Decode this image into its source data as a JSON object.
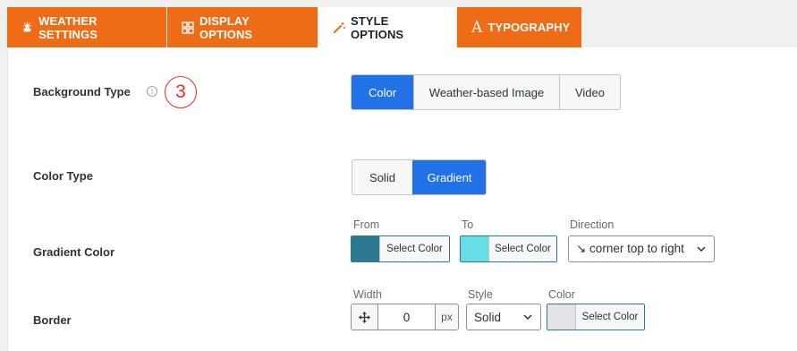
{
  "tabs": [
    {
      "label": "WEATHER SETTINGS",
      "icon": "cloud-sun-icon",
      "active": false
    },
    {
      "label": "DISPLAY OPTIONS",
      "icon": "grid-icon",
      "active": false
    },
    {
      "label": "STYLE OPTIONS",
      "icon": "magic-wand-icon",
      "active": true
    },
    {
      "label": "TYPOGRAPHY",
      "icon": "font-a-icon",
      "active": false
    }
  ],
  "background_type": {
    "label": "Background Type",
    "info_glyph": "i",
    "badge": "3",
    "options": [
      "Color",
      "Weather-based Image",
      "Video"
    ],
    "selected": "Color"
  },
  "color_type": {
    "label": "Color Type",
    "options": [
      "Solid",
      "Gradient"
    ],
    "selected": "Gradient"
  },
  "gradient_color": {
    "label": "Gradient Color",
    "from_label": "From",
    "from_color": "#2c7a8f",
    "from_button": "Select Color",
    "to_label": "To",
    "to_color": "#67dde5",
    "to_button": "Select Color",
    "direction_label": "Direction",
    "direction_value": "↘ corner top to right"
  },
  "border": {
    "label": "Border",
    "width_label": "Width",
    "width_value": "0",
    "unit": "px",
    "style_label": "Style",
    "style_value": "Solid",
    "color_label": "Color",
    "color_swatch": "#e3e3e5",
    "color_button": "Select Color"
  },
  "colors": {
    "accent_orange": "#ef6c17",
    "primary_blue": "#2271e6",
    "badge_red": "#e0321c"
  }
}
